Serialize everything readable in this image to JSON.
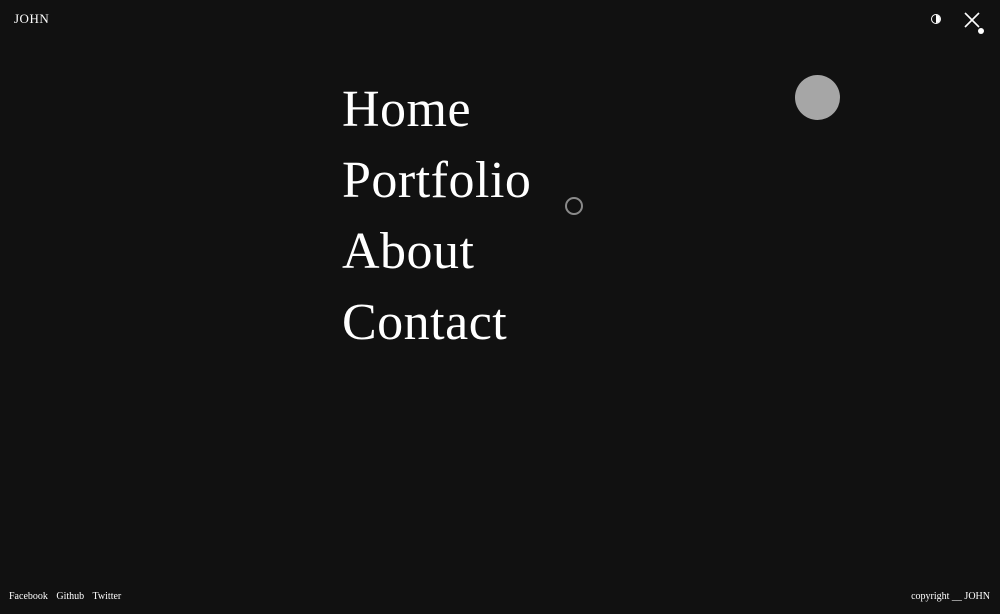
{
  "header": {
    "logo": "JOHN",
    "theme_toggle_icon": "half-circle-icon",
    "close_icon": "close-icon"
  },
  "menu": {
    "items": [
      {
        "label": "Home"
      },
      {
        "label": "Portfolio"
      },
      {
        "label": "About"
      },
      {
        "label": "Contact"
      }
    ]
  },
  "footer": {
    "social": [
      {
        "label": "Facebook"
      },
      {
        "label": "Github"
      },
      {
        "label": "Twitter"
      }
    ],
    "copyright": "copyright __ JOHN"
  },
  "colors": {
    "background": "#111111",
    "text": "#ffffff",
    "blob": "#a6a6a6",
    "cursor_ring": "#8a8a8a"
  }
}
